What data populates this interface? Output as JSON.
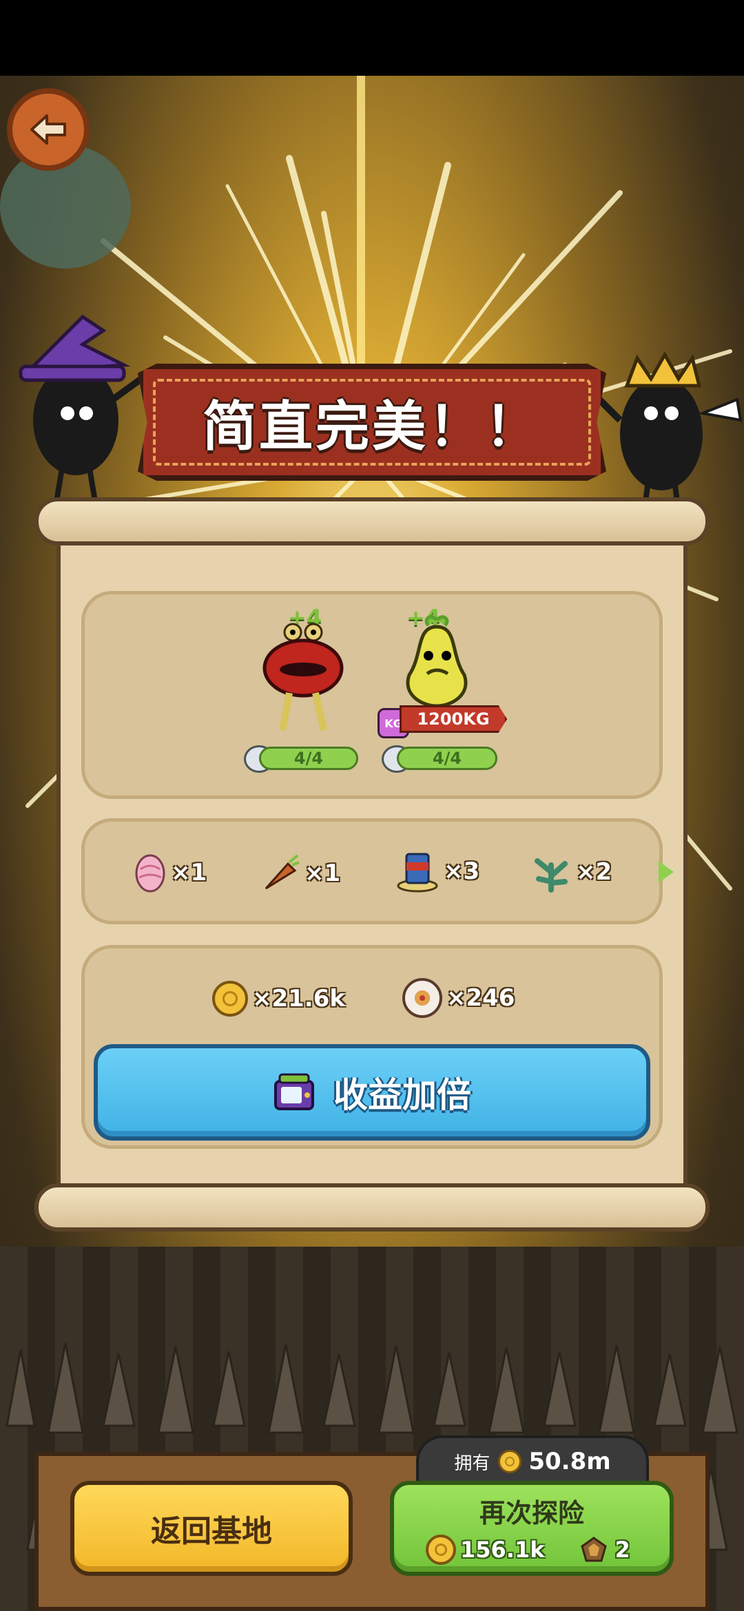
{
  "banner": {
    "title": "简直完美！！"
  },
  "monsters": [
    {
      "name_icon": "lips-monster-icon",
      "plus": "+4",
      "level": "4/4"
    },
    {
      "name_icon": "pear-monster-icon",
      "plus": "+4",
      "level": "4/4",
      "weight": "1200KG",
      "weight_icon_text": "KG"
    }
  ],
  "items": [
    {
      "icon": "pink-egg-icon",
      "count": "×1"
    },
    {
      "icon": "carrot-icon",
      "count": "×1"
    },
    {
      "icon": "can-icon",
      "count": "×3"
    },
    {
      "icon": "herb-icon",
      "count": "×2"
    }
  ],
  "rewards": {
    "coins": "×21.6k",
    "eyes": "×246"
  },
  "double_button": {
    "label": "收益加倍"
  },
  "bottom": {
    "home_label": "返回基地",
    "own_label": "拥有",
    "own_amount": "50.8m",
    "again_label": "再次探险",
    "again_cost": "156.1k",
    "again_tickets": "2"
  },
  "colors": {
    "banner": "#9c3020",
    "double_button": "#40b2e6",
    "home_button": "#f2b728",
    "again_button": "#72c43a"
  }
}
